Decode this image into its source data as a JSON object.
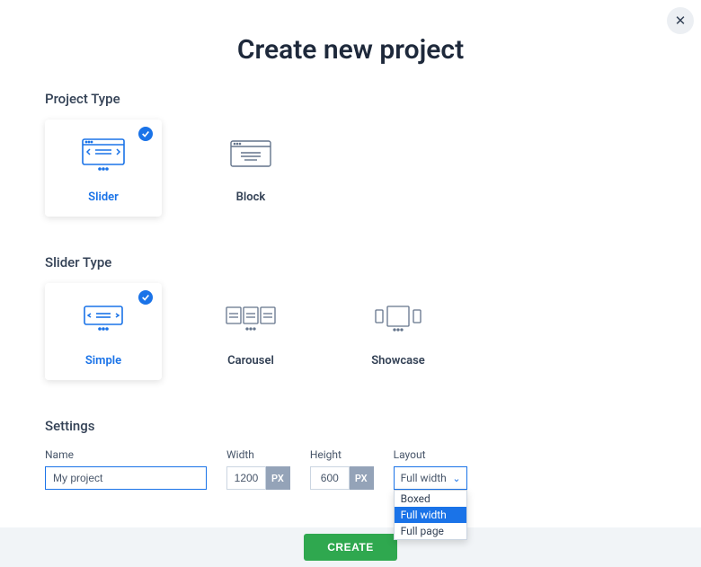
{
  "title": "Create new project",
  "close_label": "×",
  "sections": {
    "project_type": {
      "label": "Project Type",
      "options": [
        {
          "id": "slider",
          "label": "Slider",
          "selected": true
        },
        {
          "id": "block",
          "label": "Block",
          "selected": false
        }
      ]
    },
    "slider_type": {
      "label": "Slider Type",
      "options": [
        {
          "id": "simple",
          "label": "Simple",
          "selected": true
        },
        {
          "id": "carousel",
          "label": "Carousel",
          "selected": false
        },
        {
          "id": "showcase",
          "label": "Showcase",
          "selected": false
        }
      ]
    },
    "settings": {
      "label": "Settings",
      "name": {
        "label": "Name",
        "value": "My project"
      },
      "width": {
        "label": "Width",
        "value": "1200",
        "unit": "PX"
      },
      "height": {
        "label": "Height",
        "value": "600",
        "unit": "PX"
      },
      "layout": {
        "label": "Layout",
        "value": "Full width",
        "options": [
          "Boxed",
          "Full width",
          "Full page"
        ],
        "highlighted": "Full width"
      }
    }
  },
  "footer": {
    "create": "CREATE"
  },
  "colors": {
    "accent": "#1a73e8",
    "success": "#2fa84f"
  }
}
